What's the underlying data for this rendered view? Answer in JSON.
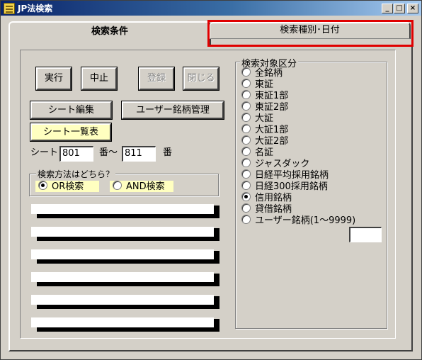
{
  "window": {
    "title": "JP法検索",
    "minimize_symbol": "_",
    "maximize_symbol": "□",
    "close_symbol": "×"
  },
  "tabs": [
    {
      "label": "検索条件",
      "active": true
    },
    {
      "label": "検索種別･日付",
      "active": false
    }
  ],
  "buttons": {
    "run": "実行",
    "stop": "中止",
    "register": "登録",
    "close": "閉じる",
    "sheet_edit": "シート編集",
    "user_stock_manage": "ユーザー銘柄管理",
    "sheet_list": "シート一覧表"
  },
  "sheet_range": {
    "label": "シート",
    "from_value": "801",
    "separator": "番～",
    "to_value": "811",
    "suffix": "番"
  },
  "search_method": {
    "legend": "検索方法はどちら？",
    "options": [
      {
        "label": "OR検索",
        "checked": true
      },
      {
        "label": "AND検索",
        "checked": false
      }
    ]
  },
  "sheet_rows_count_visible": 6,
  "target_division": {
    "legend": "検索対象区分",
    "options": [
      {
        "label": "全銘柄",
        "checked": false
      },
      {
        "label": "東証",
        "checked": false
      },
      {
        "label": "東証1部",
        "checked": false
      },
      {
        "label": "東証2部",
        "checked": false
      },
      {
        "label": "大証",
        "checked": false
      },
      {
        "label": "大証1部",
        "checked": false
      },
      {
        "label": "大証2部",
        "checked": false
      },
      {
        "label": "名証",
        "checked": false
      },
      {
        "label": "ジャスダック",
        "checked": false
      },
      {
        "label": "日経平均採用銘柄",
        "checked": false
      },
      {
        "label": "日経300採用銘柄",
        "checked": false
      },
      {
        "label": "信用銘柄",
        "checked": true
      },
      {
        "label": "貸借銘柄",
        "checked": false
      },
      {
        "label": "ユーザー銘柄(1～9999)",
        "checked": false
      }
    ],
    "user_stock_input_value": ""
  },
  "colors": {
    "face": "#d4d0c8",
    "highlight_box": "#e00000",
    "yellow_control": "#ffffc0"
  }
}
